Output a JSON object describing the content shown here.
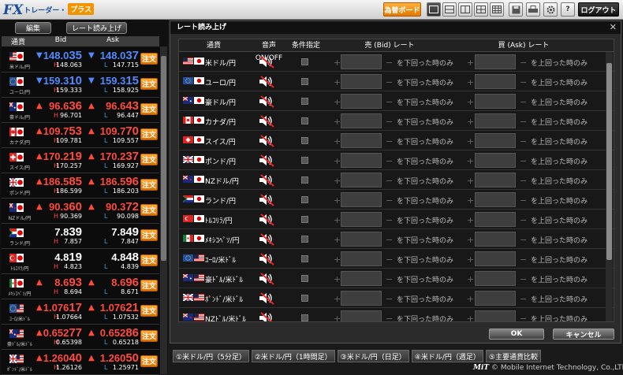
{
  "app": {
    "logo_fx": "FX",
    "logo_trader": "トレーダー・",
    "logo_plus": "プラス"
  },
  "toolbar": {
    "order_board": "為替ボード",
    "logout": "ログアウト"
  },
  "left": {
    "edit_label": "編集",
    "rate_read_label": "レート読み上げ",
    "col_pair": "通貨",
    "col_bid": "Bid",
    "col_ask": "Ask",
    "order_label": "注文",
    "high_label": "H",
    "low_label": "L"
  },
  "quotes": [
    {
      "name": "米ドル/円",
      "flag": "us",
      "flag2": "jp",
      "bid_a": "148.0",
      "bid_b": "35",
      "ask_a": "148.0",
      "ask_b": "37",
      "dir": "down",
      "high": "148.063",
      "low": "147.715",
      "color": "blue"
    },
    {
      "name": "ユーロ/円",
      "flag": "eu",
      "flag2": "jp",
      "bid_a": "159.3",
      "bid_b": "10",
      "ask_a": "159.3",
      "ask_b": "15",
      "dir": "down",
      "high": "159.333",
      "low": "158.925",
      "color": "blue"
    },
    {
      "name": "豪ドル/円",
      "flag": "au",
      "flag2": "jp",
      "bid_a": "96.6",
      "bid_b": "36",
      "ask_a": "96.6",
      "ask_b": "43",
      "dir": "up",
      "high": "96.701",
      "low": "96.447",
      "color": "red"
    },
    {
      "name": "カナダ/円",
      "flag": "ca",
      "flag2": "jp",
      "bid_a": "109.7",
      "bid_b": "53",
      "ask_a": "109.7",
      "ask_b": "70",
      "dir": "up",
      "high": "109.781",
      "low": "109.557",
      "color": "red"
    },
    {
      "name": "スイス/円",
      "flag": "ch",
      "flag2": "jp",
      "bid_a": "170.2",
      "bid_b": "19",
      "ask_a": "170.2",
      "ask_b": "37",
      "dir": "up",
      "high": "170.257",
      "low": "169.927",
      "color": "red"
    },
    {
      "name": "ポンド/円",
      "flag": "gb",
      "flag2": "jp",
      "bid_a": "186.5",
      "bid_b": "85",
      "ask_a": "186.5",
      "ask_b": "96",
      "dir": "up",
      "high": "186.599",
      "low": "186.203",
      "color": "red"
    },
    {
      "name": "NZドル/円",
      "flag": "nz",
      "flag2": "jp",
      "bid_a": "90.3",
      "bid_b": "60",
      "ask_a": "90.3",
      "ask_b": "72",
      "dir": "up",
      "high": "90.369",
      "low": "90.098",
      "color": "red"
    },
    {
      "name": "ランド/円",
      "flag": "za",
      "flag2": "jp",
      "bid_a": "7.8",
      "bid_b": "39",
      "ask_a": "7.8",
      "ask_b": "49",
      "dir": "none",
      "high": "7.857",
      "low": "7.847",
      "color": "white"
    },
    {
      "name": "ﾄﾙｺﾘﾗ/円",
      "flag": "tr",
      "flag2": "jp",
      "bid_a": "4.8",
      "bid_b": "19",
      "ask_a": "4.8",
      "ask_b": "48",
      "dir": "none",
      "high": "4.823",
      "low": "4.839",
      "color": "white"
    },
    {
      "name": "ﾒｷｼｺﾍﾟｿ/円",
      "flag": "mx",
      "flag2": "jp",
      "bid_a": "8.6",
      "bid_b": "93",
      "ask_a": "8.6",
      "ask_b": "96",
      "dir": "up",
      "high": "8.694",
      "low": "8.671",
      "color": "red"
    },
    {
      "name": "ﾕｰﾛ/米ﾄﾞﾙ",
      "flag": "eu",
      "flag2": "us",
      "bid_a": "1.076",
      "bid_b": "17",
      "ask_a": "1.076",
      "ask_b": "21",
      "dir": "up",
      "high": "1.07664",
      "low": "1.07532",
      "color": "red"
    },
    {
      "name": "豪ﾄﾞﾙ/米ﾄﾞﾙ",
      "flag": "au",
      "flag2": "us",
      "bid_a": "0.652",
      "bid_b": "77",
      "ask_a": "0.652",
      "ask_b": "86",
      "dir": "up",
      "high": "0.65398",
      "low": "0.65218",
      "color": "red"
    },
    {
      "name": "ﾎﾟﾝﾄﾞ/米ﾄﾞﾙ",
      "flag": "gb",
      "flag2": "us",
      "bid_a": "1.260",
      "bid_b": "40",
      "ask_a": "1.260",
      "ask_b": "50",
      "dir": "up",
      "high": "1.26126",
      "low": "1.25971",
      "color": "red"
    }
  ],
  "dialog": {
    "title": "レート読み上げ",
    "col_pair": "通貨",
    "col_voice": "音声ON/OFF",
    "col_cond": "条件指定",
    "col_bid": "売 (Bid) レート",
    "col_ask": "買 (Ask) レート",
    "below_text": "を下回った時のみ",
    "above_text": "を上回った時のみ",
    "ok": "OK",
    "cancel": "キャンセル"
  },
  "alerts": [
    {
      "name": "米ドル/円",
      "flag": "us",
      "flag2": "jp"
    },
    {
      "name": "ユーロ/円",
      "flag": "eu",
      "flag2": "jp"
    },
    {
      "name": "豪ドル/円",
      "flag": "au",
      "flag2": "jp"
    },
    {
      "name": "カナダ/円",
      "flag": "ca",
      "flag2": "jp"
    },
    {
      "name": "スイス/円",
      "flag": "ch",
      "flag2": "jp"
    },
    {
      "name": "ポンド/円",
      "flag": "gb",
      "flag2": "jp"
    },
    {
      "name": "NZドル/円",
      "flag": "nz",
      "flag2": "jp"
    },
    {
      "name": "ランド/円",
      "flag": "za",
      "flag2": "jp"
    },
    {
      "name": "ﾄﾙｺﾘﾗ/円",
      "flag": "tr",
      "flag2": "jp"
    },
    {
      "name": "ﾒｷｼｺﾍﾟｿ/円",
      "flag": "mx",
      "flag2": "jp"
    },
    {
      "name": "ﾕｰﾛ/米ﾄﾞﾙ",
      "flag": "eu",
      "flag2": "us"
    },
    {
      "name": "豪ﾄﾞﾙ/米ﾄﾞﾙ",
      "flag": "au",
      "flag2": "us"
    },
    {
      "name": "ﾎﾟﾝﾄﾞ/米ﾄﾞﾙ",
      "flag": "gb",
      "flag2": "us"
    },
    {
      "name": "NZﾄﾞﾙ/米ﾄﾞﾙ",
      "flag": "nz",
      "flag2": "us"
    }
  ],
  "tabs": [
    "①米ドル/円（5分足）",
    "②米ドル/円（1時間足）",
    "③米ドル/円（日足）",
    "④米ドル/円（週足）",
    "⑤主要通貨比較"
  ],
  "footer": {
    "brand": "MiT",
    "copyright": "© Mobile Internet Technology, Co.,LTD."
  }
}
